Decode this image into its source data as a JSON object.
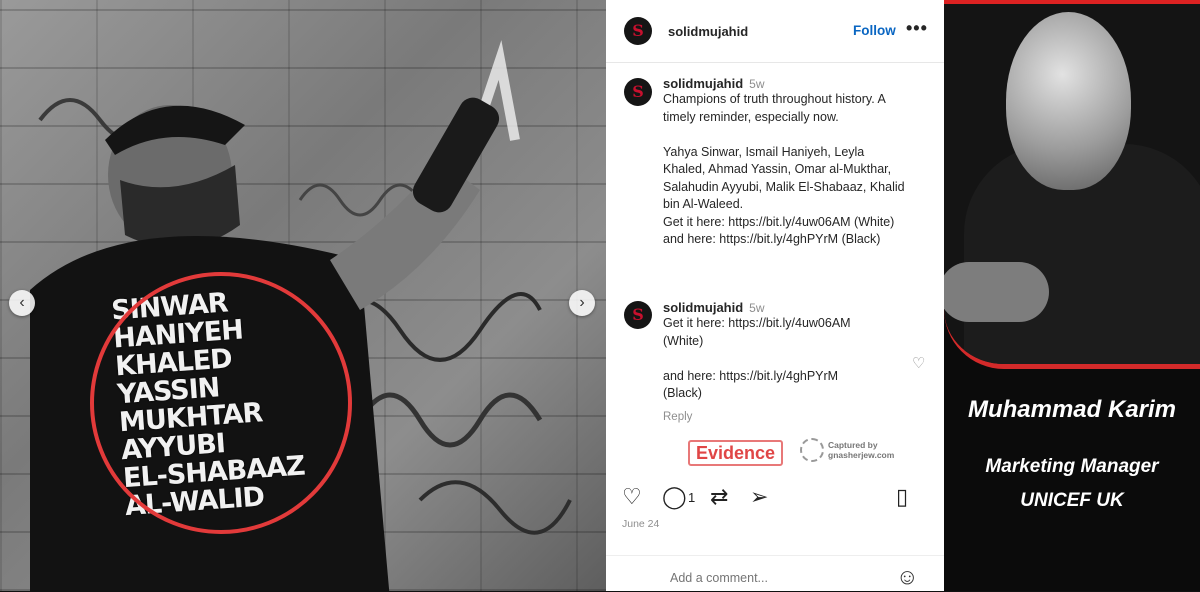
{
  "photo": {
    "shirt_lines": [
      "SINWAR",
      "HANIYEH",
      "KHALED",
      "YASSIN",
      "MUKHTAR",
      "AYYUBI",
      "EL-SHABAAZ",
      "AL-WALID"
    ]
  },
  "post": {
    "header_username": "solidmujahid",
    "follow_label": "Follow",
    "more_label": "•••",
    "caption": {
      "username": "solidmujahid",
      "age": "5w",
      "lines": [
        "Champions of truth throughout history. A",
        "timely reminder, especially now.",
        "",
        "Yahya Sinwar, Ismail Haniyeh, Leyla",
        "Khaled, Ahmad Yassin, Omar al-Mukthar,",
        "Salahudin Ayyubi, Malik El-Shabaaz, Khalid",
        "bin Al-Waleed.",
        "Get it here: https://bit.ly/4uw06AM (White)",
        "and here: https://bit.ly/4ghPYrM (Black)"
      ]
    },
    "comment": {
      "username": "solidmujahid",
      "age": "5w",
      "lines": [
        "Get it here: https://bit.ly/4uw06AM",
        "(White)",
        "",
        "and here: https://bit.ly/4ghPYrM",
        "(Black)"
      ],
      "reply_label": "Reply"
    },
    "evidence_label": "Evidence",
    "captured_by_line1": "Captured by",
    "captured_by_line2": "gnasherjew.com",
    "comment_count": "1",
    "date": "June 24",
    "add_comment_placeholder": "Add a comment..."
  },
  "profile": {
    "name": "Muhammad Karim",
    "role_line1": "Marketing Manager",
    "role_line2": "UNICEF UK"
  },
  "colors": {
    "accent_red": "#d22",
    "link_blue": "#0a66c2"
  }
}
